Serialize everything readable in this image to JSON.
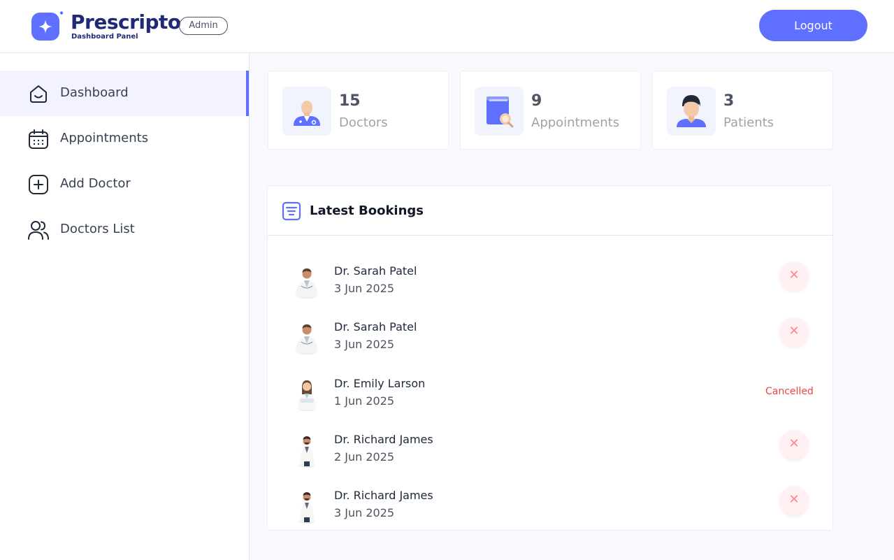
{
  "header": {
    "brand": "Prescripto",
    "subtitle": "Dashboard Panel",
    "role_badge": "Admin",
    "logout_label": "Logout"
  },
  "colors": {
    "accent": "#5f6fff",
    "brand_text": "#1e2a78",
    "cancelled": "#ef4444",
    "active_bg": "#f2f3ff"
  },
  "sidebar": {
    "items": [
      {
        "label": "Dashboard",
        "icon": "home-icon",
        "active": true
      },
      {
        "label": "Appointments",
        "icon": "calendar-icon",
        "active": false
      },
      {
        "label": "Add Doctor",
        "icon": "add-square-icon",
        "active": false
      },
      {
        "label": "Doctors List",
        "icon": "people-icon",
        "active": false
      }
    ]
  },
  "stats": [
    {
      "value": "15",
      "label": "Doctors",
      "icon": "doctor-icon"
    },
    {
      "value": "9",
      "label": "Appointments",
      "icon": "appointments-book-icon"
    },
    {
      "value": "3",
      "label": "Patients",
      "icon": "patient-icon"
    }
  ],
  "bookings": {
    "title": "Latest Bookings",
    "rows": [
      {
        "name": "Dr. Sarah Patel",
        "date": "3 Jun 2025",
        "status": "",
        "action": "cancel"
      },
      {
        "name": "Dr. Sarah Patel",
        "date": "3 Jun 2025",
        "status": "",
        "action": "cancel"
      },
      {
        "name": "Dr. Emily Larson",
        "date": "1 Jun 2025",
        "status": "Cancelled",
        "action": ""
      },
      {
        "name": "Dr. Richard James",
        "date": "2 Jun 2025",
        "status": "",
        "action": "cancel"
      },
      {
        "name": "Dr. Richard James",
        "date": "3 Jun 2025",
        "status": "",
        "action": "cancel"
      }
    ]
  }
}
